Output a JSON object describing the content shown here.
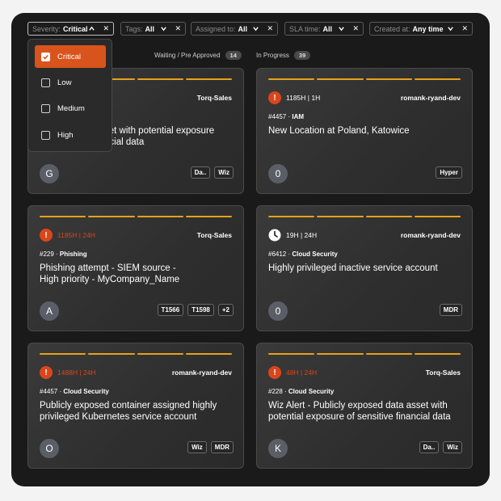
{
  "filters": [
    {
      "label": "Severity:",
      "value": "Critical",
      "chevron": "up"
    },
    {
      "label": "Tags:",
      "value": "All",
      "chevron": "down"
    },
    {
      "label": "Assigned to:",
      "value": "All",
      "chevron": "down"
    },
    {
      "label": "SLA time:",
      "value": "All",
      "chevron": "down"
    },
    {
      "label": "Created at:",
      "value": "Any time",
      "chevron": "down"
    }
  ],
  "columns": [
    {
      "label": "Waiting / Pre Approved",
      "count": "14"
    },
    {
      "label": "In Progress",
      "count": "39"
    }
  ],
  "severity_options": [
    {
      "label": "Critical",
      "checked": true
    },
    {
      "label": "Low",
      "checked": false
    },
    {
      "label": "Medium",
      "checked": false
    },
    {
      "label": "High",
      "checked": false
    }
  ],
  "cards": [
    {
      "sla": "",
      "owner": "Torq-Sales",
      "category_id": "",
      "category": "",
      "title_lines": [
        "",
        "set with potential exposure",
        "ncial data"
      ],
      "avatar": "G",
      "tags": [
        "Da..",
        "Wiz"
      ],
      "icon": "none"
    },
    {
      "sla": "1185H | 1H",
      "owner": "romank-ryand-dev",
      "category_id": "#4457 · ",
      "category": "IAM",
      "title_lines": [
        "New Location at Poland, Katowice"
      ],
      "avatar": "0",
      "tags": [
        "Hyper"
      ],
      "icon": "alert"
    },
    {
      "sla": "1185H | 24H",
      "owner": "Torq-Sales",
      "category_id": "#229 · ",
      "category": "Phishing",
      "title_lines": [
        "Phishing attempt - SIEM source -",
        "High priority - MyCompany_Name"
      ],
      "avatar": "A",
      "tags": [
        "T1566",
        "T1598",
        "+2"
      ],
      "icon": "alert"
    },
    {
      "sla": "19H | 24H",
      "owner": "romank-ryand-dev",
      "category_id": "#6412 · ",
      "category": "Cloud Security",
      "title_lines": [
        "Highly privileged inactive service account"
      ],
      "avatar": "0",
      "tags": [
        "MDR"
      ],
      "icon": "clock"
    },
    {
      "sla": "1488H | 24H",
      "owner": "romank-ryand-dev",
      "category_id": "#4457 · ",
      "category": "Cloud Security",
      "title_lines": [
        "Publicly exposed container assigned highly",
        "privileged Kubernetes service account"
      ],
      "avatar": "O",
      "tags": [
        "Wiz",
        "MDR"
      ],
      "icon": "alert"
    },
    {
      "sla": "48H | 24H",
      "owner": "Torq-Sales",
      "category_id": "#228 · ",
      "category": "Cloud Security",
      "title_lines": [
        "Wiz Alert - Publicly exposed data asset with",
        "potential exposure of sensitive financial data"
      ],
      "avatar": "K",
      "tags": [
        "Da..",
        "Wiz"
      ],
      "icon": "alert"
    }
  ],
  "colors": {
    "accent": "#d9541c",
    "sla_bar": "#e6a21a",
    "background": "#1a1a1a"
  }
}
